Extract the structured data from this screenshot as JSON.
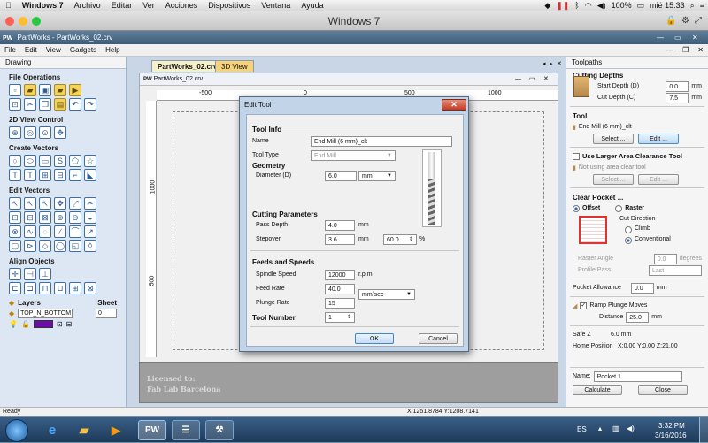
{
  "mac": {
    "apple": "",
    "app": "Windows 7",
    "menus": [
      "Archivo",
      "Editar",
      "Ver",
      "Acciones",
      "Dispositivos",
      "Ventana",
      "Ayuda"
    ],
    "battery": "100%",
    "clock": "mié 15:33"
  },
  "vm_title": "Windows 7",
  "window_title": "PartWorks - PartWorks_02.crv",
  "menu": [
    "File",
    "Edit",
    "View",
    "Gadgets",
    "Help"
  ],
  "left": {
    "panel_title": "Drawing",
    "sections": [
      "File Operations",
      "2D View Control",
      "Create Vectors",
      "Edit Vectors",
      "Align Objects"
    ],
    "layers_label": "Layers",
    "sheet_label": "Sheet",
    "layer_value": "TOP_N_BOTTOM",
    "sheet_value": "0"
  },
  "tabs": {
    "doc": "PartWorks_02.crv",
    "view3d": "3D View"
  },
  "docwin_title": "PartWorks_02.crv",
  "ruler": {
    "h": [
      "-500",
      "0",
      "500",
      "1000"
    ],
    "v": [
      "1000",
      "500"
    ]
  },
  "licence": {
    "line1": "Licensed to:",
    "line2": "Fab Lab Barcelona"
  },
  "dialog": {
    "title": "Edit Tool",
    "tool_info": "Tool Info",
    "name_label": "Name",
    "name_value": "End Mill (6 mm)_clt",
    "type_label": "Tool Type",
    "type_value": "End Mill",
    "geometry": "Geometry",
    "diameter_label": "Diameter (D)",
    "diameter_value": "6.0",
    "diameter_unit": "mm",
    "cutting": "Cutting Parameters",
    "pass_label": "Pass Depth",
    "pass_value": "4.0",
    "pass_unit": "mm",
    "step_label": "Stepover",
    "step_value": "3.6",
    "step_unit": "mm",
    "step_pct": "60.0",
    "pct": "%",
    "feeds": "Feeds and Speeds",
    "spindle_label": "Spindle Speed",
    "spindle_value": "12000",
    "spindle_unit": "r.p.m",
    "feed_label": "Feed Rate",
    "feed_value": "40.0",
    "feed_unit": "mm/sec",
    "plunge_label": "Plunge Rate",
    "plunge_value": "15",
    "toolnum_label": "Tool Number",
    "toolnum_value": "1",
    "ok": "OK",
    "cancel": "Cancel"
  },
  "right": {
    "title": "Toolpaths",
    "cutting_depths": "Cutting Depths",
    "start_label": "Start Depth (D)",
    "start_value": "0.0",
    "cut_label": "Cut Depth (C)",
    "cut_value": "7.5",
    "unit": "mm",
    "tool": "Tool",
    "tool_name": "End Mill (6 mm)_clt",
    "select": "Select ...",
    "edit": "Edit ...",
    "larger_tool": "Use Larger Area Clearance Tool",
    "no_area_tool": "Not using area clear tool",
    "clear_pocket": "Clear Pocket ...",
    "offset": "Offset",
    "raster": "Raster",
    "cut_direction": "Cut Direction",
    "climb": "Climb",
    "conventional": "Conventional",
    "raster_angle": "Raster Angle",
    "raster_angle_value": "0.0",
    "degrees": "degrees",
    "profile_pass": "Profile Pass",
    "profile_value": "Last",
    "pocket_allow": "Pocket Allowance",
    "pocket_value": "0.0",
    "ramp": "Ramp Plunge Moves",
    "distance_label": "Distance",
    "distance_value": "25.0",
    "safez_label": "Safe Z",
    "safez_value": "6.0 mm",
    "home_label": "Home Position",
    "home_value": "X:0.00 Y:0.00 Z:21.00",
    "name_label": "Name:",
    "name_value": "Pocket 1",
    "calculate": "Calculate",
    "close": "Close"
  },
  "status": {
    "left": "Ready",
    "coords": "X:1251.8784 Y:1208.7141"
  },
  "taskbar": {
    "lang": "ES",
    "time": "3:32 PM",
    "date": "3/16/2016",
    "pw": "PW"
  }
}
